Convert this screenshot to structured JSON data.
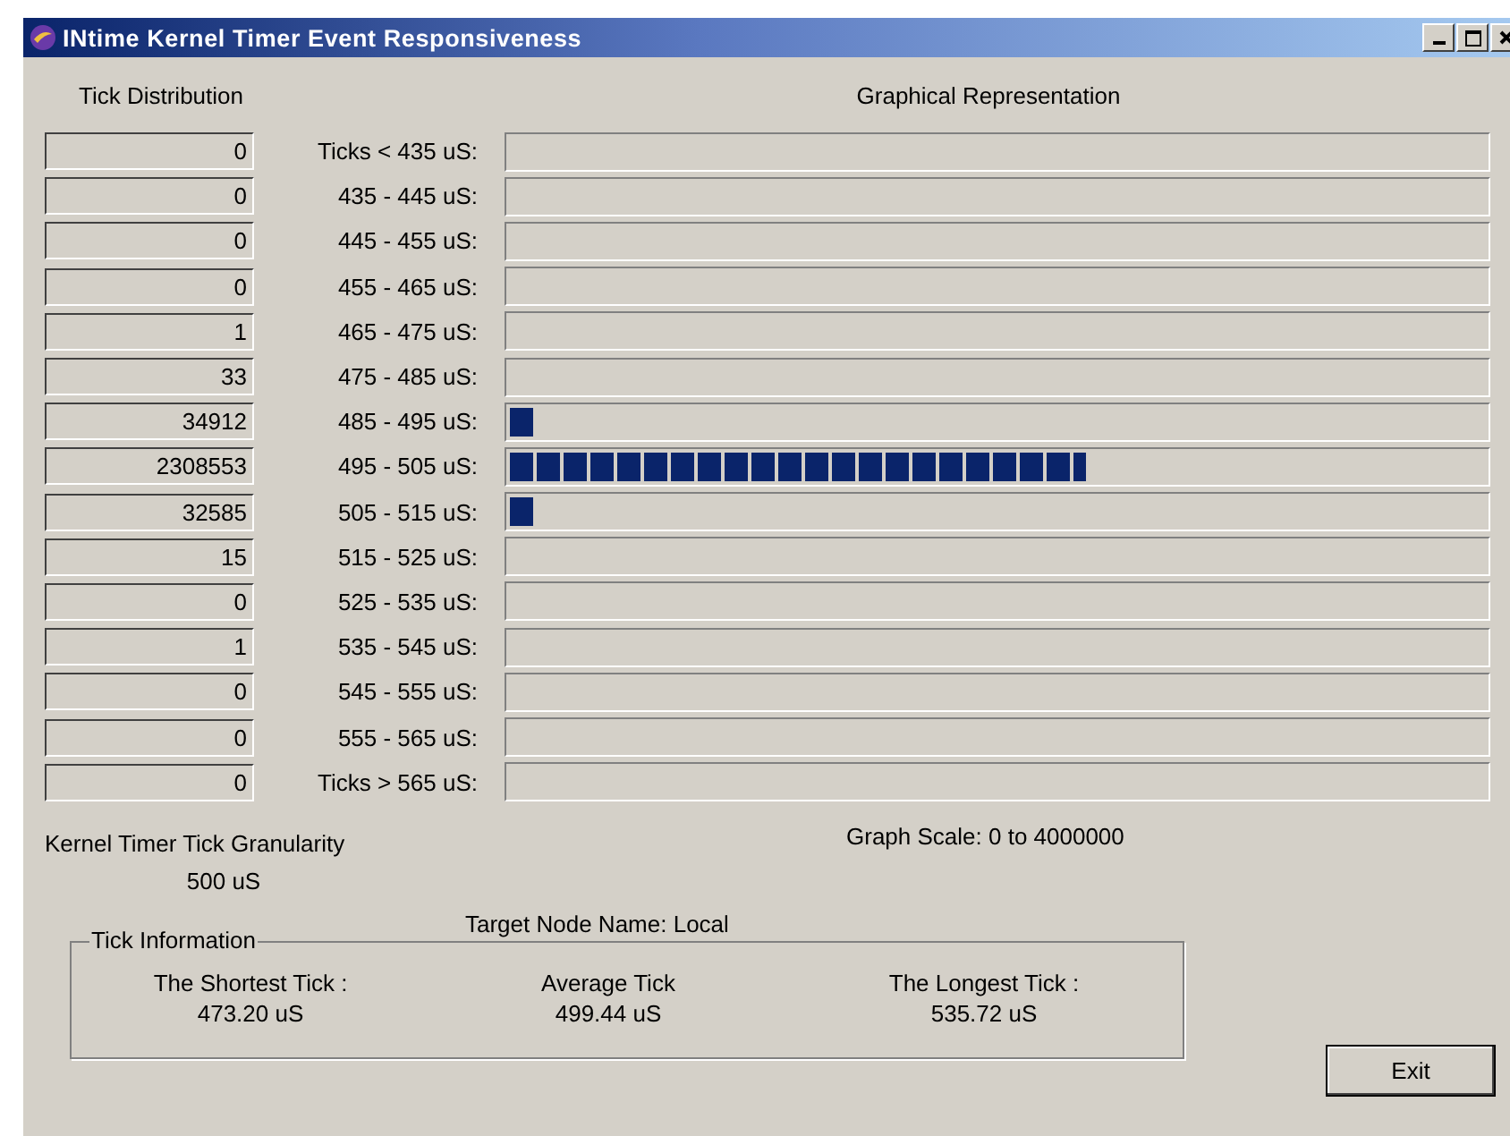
{
  "window": {
    "title": "INtime Kernel Timer Event Responsiveness"
  },
  "headings": {
    "distribution": "Tick Distribution",
    "graph": "Graphical Representation"
  },
  "rows": [
    {
      "count": "0",
      "range": "Ticks < 435  uS:"
    },
    {
      "count": "0",
      "range": "435 - 445  uS:"
    },
    {
      "count": "0",
      "range": "445 - 455  uS:"
    },
    {
      "count": "0",
      "range": "455 - 465  uS:"
    },
    {
      "count": "1",
      "range": "465 - 475  uS:"
    },
    {
      "count": "33",
      "range": "475 - 485  uS:"
    },
    {
      "count": "34912",
      "range": "485 - 495  uS:",
      "level": 0.027
    },
    {
      "count": "2308553",
      "range": "495 - 505  uS:",
      "level": 0.59
    },
    {
      "count": "32585",
      "range": "505 - 515  uS:",
      "level": 0.027
    },
    {
      "count": "15",
      "range": "515 - 525  uS:"
    },
    {
      "count": "0",
      "range": "525 - 535  uS:"
    },
    {
      "count": "1",
      "range": "535 - 545  uS:"
    },
    {
      "count": "0",
      "range": "545 - 555  uS:"
    },
    {
      "count": "0",
      "range": "555 - 565  uS:"
    },
    {
      "count": "0",
      "range": "Ticks > 565  uS:"
    }
  ],
  "granularity": {
    "label": "Kernel Timer Tick Granularity",
    "value": "500 uS"
  },
  "graph_scale": "Graph Scale: 0  to 4000000",
  "target_node": "Target Node Name: Local",
  "tick_information": {
    "title": "Tick Information",
    "items": [
      {
        "label": "The Shortest Tick :",
        "value": "473.20 uS"
      },
      {
        "label": "Average Tick",
        "value": "499.44 uS"
      },
      {
        "label": "The Longest Tick :",
        "value": "535.72 uS"
      }
    ]
  },
  "buttons": [
    "Exit"
  ]
}
